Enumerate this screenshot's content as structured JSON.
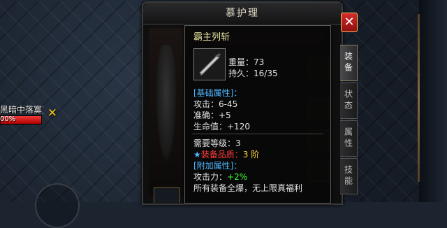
{
  "player": {
    "name": "黑暗中落寞)",
    "hp_text": "00%",
    "hp_fraction": 1.0
  },
  "target_close": "✕",
  "panel": {
    "title": "慕护理",
    "close": "✕"
  },
  "tabs": [
    {
      "label": "装备",
      "active": true
    },
    {
      "label": "状态",
      "active": false
    },
    {
      "label": "属性",
      "active": false
    },
    {
      "label": "技能",
      "active": false
    }
  ],
  "tooltip": {
    "item_name": "霸主列斩",
    "weight": "重量：73",
    "durability": "持久：16/35",
    "base_header": "[基础属性]：",
    "attack": "攻击：6-45",
    "accuracy": "准确：+5",
    "hp": "生命值：+120",
    "req_level": "需要等级：3",
    "star": "★",
    "quality_label": "装备品质：",
    "quality_value": "3 阶",
    "extra_header": "[附加属性]：",
    "atk_power_label": "攻击力：",
    "atk_power_value": "+2%",
    "drop_note": "所有装备全爆，无上限真福利"
  },
  "colors": {
    "accent_blue": "#4fb8ff",
    "quality_red": "#ff3a3a",
    "quality_yellow": "#ffd23a",
    "green": "#3aff3a",
    "name_yellow": "#e8e6a0"
  }
}
